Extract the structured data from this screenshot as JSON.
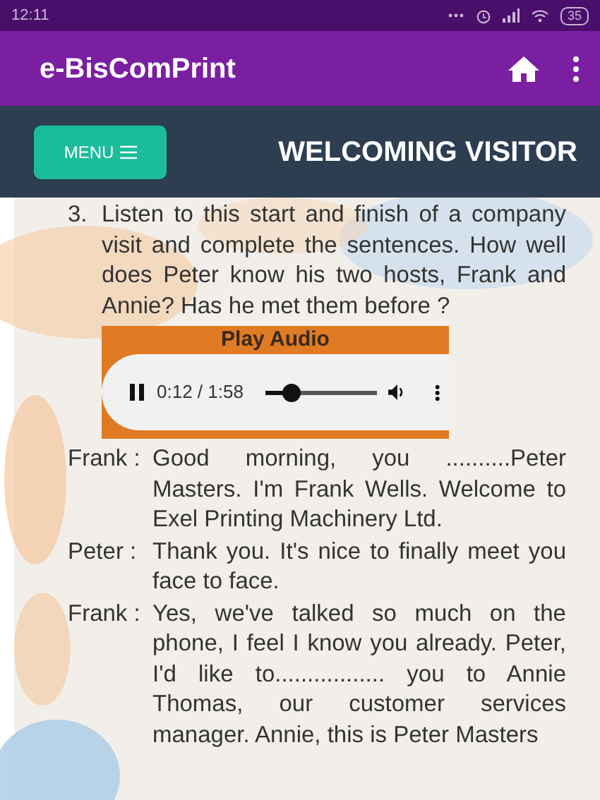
{
  "status_bar": {
    "time": "12:11",
    "battery": "35"
  },
  "app_bar": {
    "title": "e-BisComPrint"
  },
  "header": {
    "menu_button": "MENU",
    "title": "WELCOMING VISITOR"
  },
  "question": {
    "number": "3.",
    "text": "Listen to this start and finish of a company visit and complete the sentences. How well does Peter know his two hosts, Frank and Annie? Has he met them before ?"
  },
  "audio": {
    "label": "Play Audio",
    "playing": true,
    "time": "0:12 / 1:58",
    "level": 0.17
  },
  "dialogue": [
    {
      "speaker": "Frank :",
      "text": "Good morning, you ..........Peter Masters. I'm Frank Wells. Welcome to Exel Printing Machinery Ltd."
    },
    {
      "speaker": "Peter :",
      "text": "Thank you. It's nice to finally meet you face to face."
    },
    {
      "speaker": "Frank :",
      "text": "Yes, we've talked so much on the phone, I feel I know you already. Peter, I'd like to................. you to Annie Thomas, our customer services manager. Annie, this is Peter Masters"
    }
  ]
}
